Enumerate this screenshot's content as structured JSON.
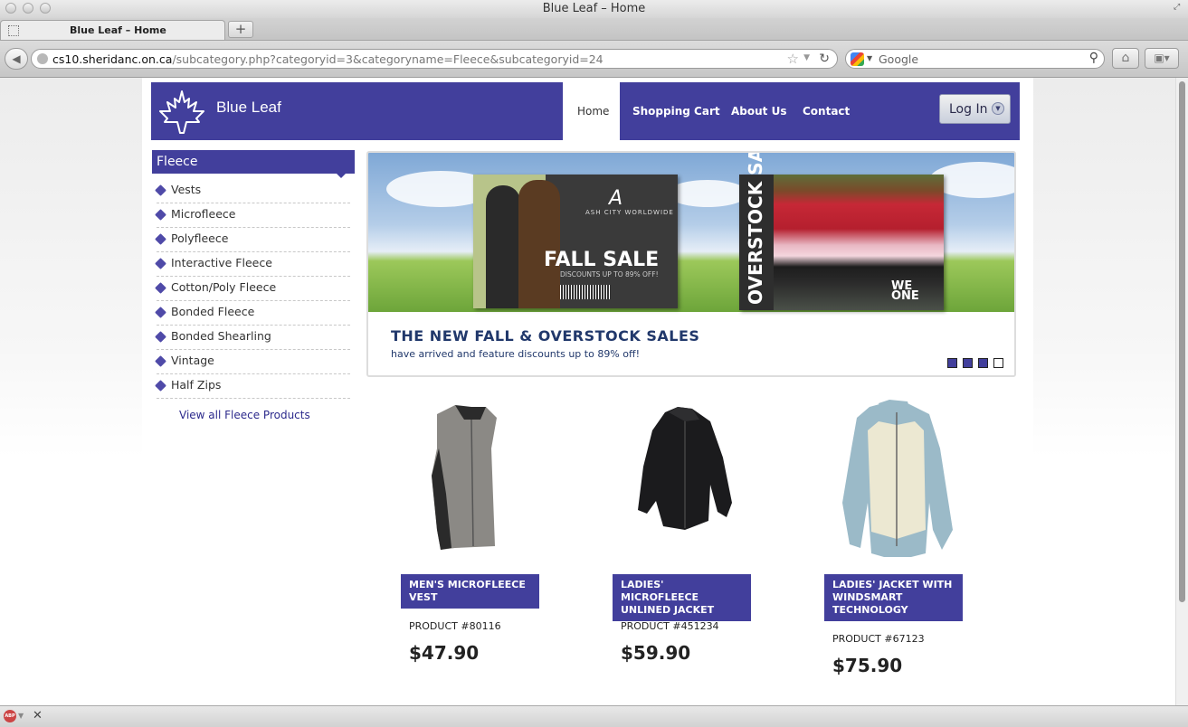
{
  "window": {
    "title": "Blue Leaf – Home"
  },
  "tab": {
    "label": "Blue Leaf – Home",
    "new_tab_label": "+"
  },
  "toolbar": {
    "url_host": "cs10.sheridanc.on.ca",
    "url_path": "/subcategory.php?categoryid=3&categoryname=Fleece&subcategoryid=24",
    "search_placeholder": "Google"
  },
  "header": {
    "brand": "Blue Leaf",
    "nav": [
      "Home",
      "Shopping Cart",
      "About Us",
      "Contact"
    ],
    "active_nav": "Home",
    "login_label": "Log In"
  },
  "sidebar": {
    "heading": "Fleece",
    "items": [
      "Vests",
      "Microfleece",
      "Polyfleece",
      "Interactive Fleece",
      "Cotton/Poly Fleece",
      "Bonded Fleece",
      "Bonded Shearling",
      "Vintage",
      "Half Zips"
    ],
    "view_all": "View all Fleece Products"
  },
  "banner": {
    "flyer1_brand": "ASH CITY WORLDWIDE",
    "flyer1_title": "FALL SALE",
    "flyer1_sub": "DISCOUNTS UP TO 89% OFF!",
    "flyer2_title": "OVERSTOCK SALE",
    "flyer2_tag": "WE ONE",
    "headline": "THE NEW FALL & OVERSTOCK SALES",
    "subline": "have arrived and feature discounts up to 89% off!",
    "slides_total": 4,
    "active_slide": 4
  },
  "products": [
    {
      "title": "MEN'S MICROFLEECE VEST",
      "number": "PRODUCT #80116",
      "price": "$47.90"
    },
    {
      "title": "LADIES' MICROFLEECE UNLINED JACKET",
      "number": "PRODUCT #451234",
      "price": "$59.90"
    },
    {
      "title": "LADIES' JACKET WITH WINDSMART TECHNOLOGY",
      "number": "PRODUCT #67123",
      "price": "$75.90"
    }
  ],
  "colors": {
    "brand_purple": "#423f9c",
    "link": "#2c2a8c"
  }
}
